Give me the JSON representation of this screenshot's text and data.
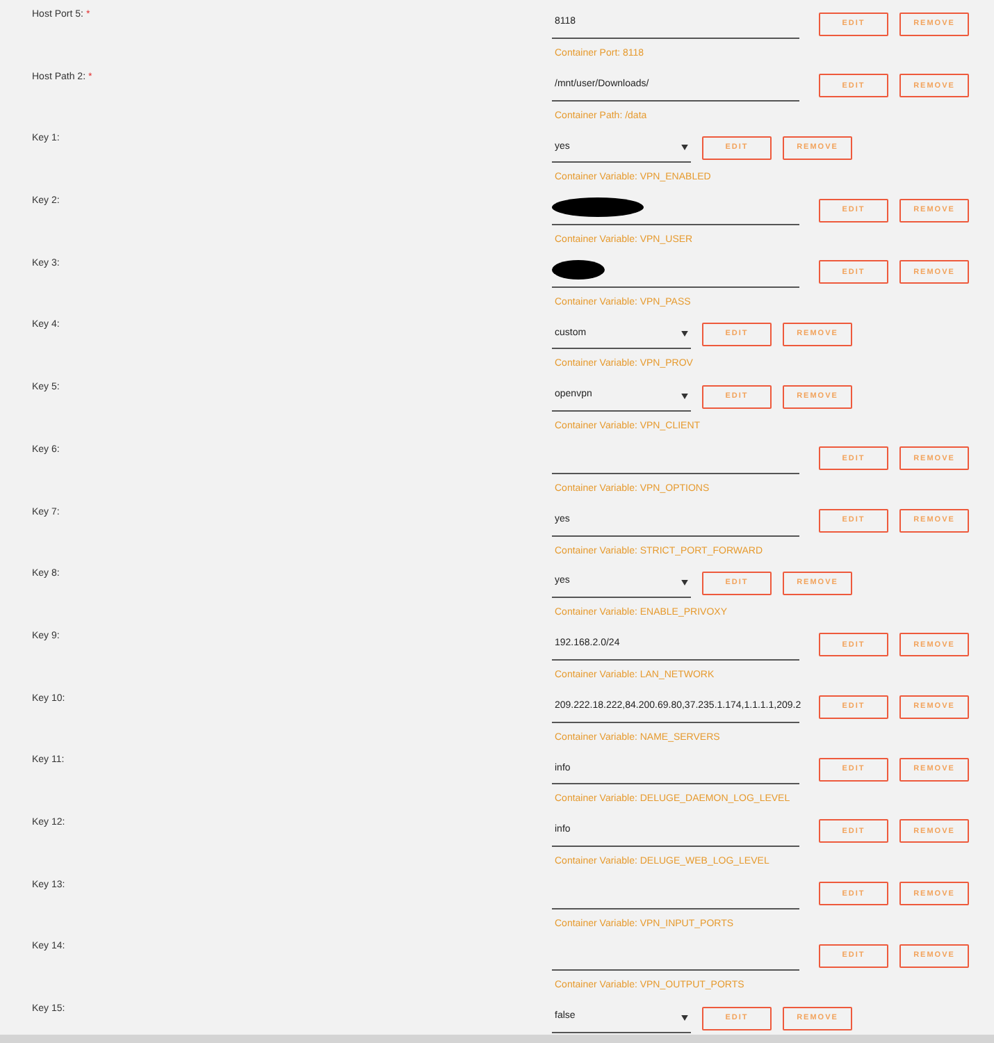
{
  "rows": [
    {
      "label": "Host Port 5:",
      "required_mark": "*",
      "kind": "text",
      "value": "8118",
      "caption": "Container Port: 8118",
      "buttons": [
        "EDIT",
        "REMOVE"
      ]
    },
    {
      "label": "Host Path 2:",
      "required_mark": "*",
      "kind": "text",
      "value": "/mnt/user/Downloads/",
      "caption": "Container Path: /data",
      "buttons": [
        "EDIT",
        "REMOVE"
      ]
    },
    {
      "label": "Key 1:",
      "kind": "select",
      "value": "yes",
      "caption": "Container Variable: VPN_ENABLED",
      "buttons": [
        "EDIT",
        "REMOVE"
      ]
    },
    {
      "label": "Key 2:",
      "kind": "text",
      "redacted": true,
      "caption": "Container Variable: VPN_USER",
      "buttons": [
        "EDIT",
        "REMOVE"
      ]
    },
    {
      "label": "Key 3:",
      "kind": "text",
      "redacted": true,
      "caption": "Container Variable: VPN_PASS",
      "buttons": [
        "EDIT",
        "REMOVE"
      ]
    },
    {
      "label": "Key 4:",
      "kind": "select",
      "value": "custom",
      "caption": "Container Variable: VPN_PROV",
      "buttons": [
        "EDIT",
        "REMOVE"
      ]
    },
    {
      "label": "Key 5:",
      "kind": "select",
      "value": "openvpn",
      "caption": "Container Variable: VPN_CLIENT",
      "buttons": [
        "EDIT",
        "REMOVE"
      ]
    },
    {
      "label": "Key 6:",
      "kind": "text",
      "caption": "Container Variable: VPN_OPTIONS",
      "buttons": [
        "EDIT",
        "REMOVE"
      ]
    },
    {
      "label": "Key 7:",
      "kind": "text",
      "value": "yes",
      "caption": "Container Variable: STRICT_PORT_FORWARD",
      "buttons": [
        "EDIT",
        "REMOVE"
      ]
    },
    {
      "label": "Key 8:",
      "kind": "select",
      "value": "yes",
      "caption": "Container Variable: ENABLE_PRIVOXY",
      "buttons": [
        "EDIT",
        "REMOVE"
      ]
    },
    {
      "label": "Key 9:",
      "kind": "text",
      "value": "192.168.2.0/24",
      "caption": "Container Variable: LAN_NETWORK",
      "buttons": [
        "EDIT",
        "REMOVE"
      ]
    },
    {
      "label": "Key 10:",
      "kind": "text",
      "value": "209.222.18.222,84.200.69.80,37.235.1.174,1.1.1.1,209.2",
      "caption": "Container Variable: NAME_SERVERS",
      "buttons": [
        "EDIT",
        "REMOVE"
      ]
    },
    {
      "label": "Key 11:",
      "kind": "text",
      "value": "info",
      "caption": "Container Variable: DELUGE_DAEMON_LOG_LEVEL",
      "buttons": [
        "EDIT",
        "REMOVE"
      ]
    },
    {
      "label": "Key 12:",
      "kind": "text",
      "value": "info",
      "caption": "Container Variable: DELUGE_WEB_LOG_LEVEL",
      "buttons": [
        "EDIT",
        "REMOVE"
      ]
    },
    {
      "label": "Key 13:",
      "kind": "text",
      "caption": "Container Variable: VPN_INPUT_PORTS",
      "buttons": [
        "EDIT",
        "REMOVE"
      ]
    },
    {
      "label": "Key 14:",
      "kind": "text",
      "caption": "Container Variable: VPN_OUTPUT_PORTS",
      "buttons": [
        "EDIT",
        "REMOVE"
      ]
    },
    {
      "label": "Key 15:",
      "kind": "select",
      "value": "false",
      "buttons": [
        "EDIT",
        "REMOVE"
      ]
    }
  ]
}
